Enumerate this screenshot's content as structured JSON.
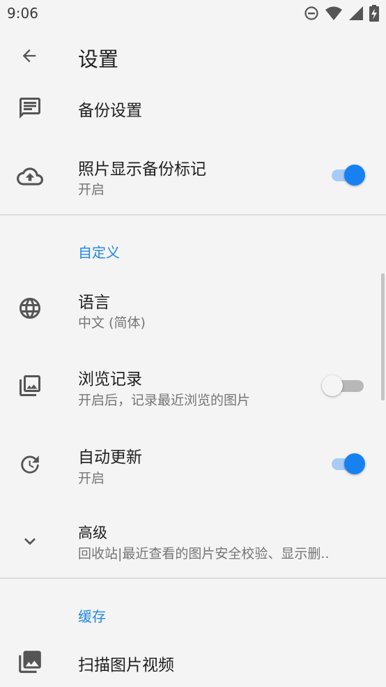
{
  "status_bar": {
    "time": "9:06",
    "icons": [
      "do-not-disturb-icon",
      "wifi-icon",
      "cell-signal-icon",
      "battery-charging-icon"
    ]
  },
  "app_bar": {
    "title": "设置",
    "back_icon": "arrow-back-icon"
  },
  "backup": {
    "settings": {
      "title": "备份设置",
      "icon": "message-icon"
    },
    "photo_marker": {
      "title": "照片显示备份标记",
      "subtitle": "开启",
      "enabled": true,
      "icon": "cloud-upload-icon"
    }
  },
  "custom": {
    "header": "自定义",
    "language": {
      "title": "语言",
      "subtitle": "中文 (简体)",
      "icon": "globe-icon"
    },
    "history": {
      "title": "浏览记录",
      "subtitle": "开启后，记录最近浏览的图片",
      "enabled": false,
      "icon": "photo-library-icon"
    },
    "auto_update": {
      "title": "自动更新",
      "subtitle": "开启",
      "enabled": true,
      "icon": "update-icon"
    },
    "advanced": {
      "title": "高级",
      "subtitle": "回收站|最近查看的图片安全校验、显示删..",
      "icon": "chevron-down-icon"
    }
  },
  "cache": {
    "header": "缓存",
    "scan": {
      "title": "扫描图片视频",
      "icon": "photo-collection-icon"
    }
  },
  "colors": {
    "accent": "#1781f2",
    "accent_track": "#a6ccf7",
    "header_text": "#1e88e5",
    "background": "#f4f4f4"
  }
}
